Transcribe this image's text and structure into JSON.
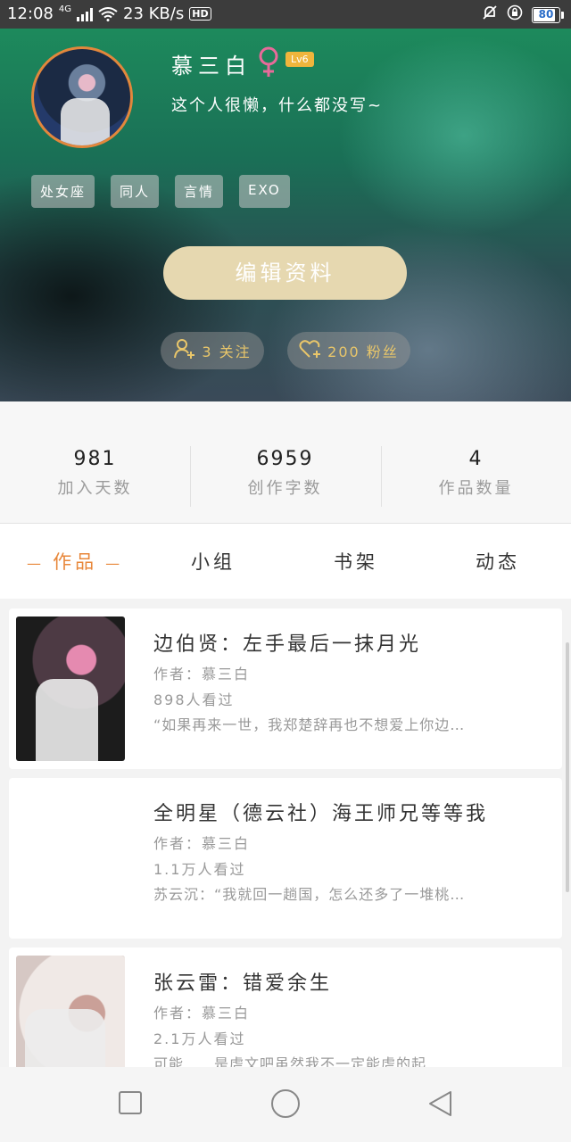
{
  "status_bar": {
    "time": "12:08",
    "network": "4G",
    "speed": "23 KB/s",
    "hd_label": "HD",
    "battery_level": "80"
  },
  "profile": {
    "username": "慕三白",
    "level": "Lv6",
    "bio": "这个人很懒，什么都没写~",
    "tags": [
      "处女座",
      "同人",
      "言情",
      "EXO"
    ],
    "edit_button": "编辑资料",
    "following": "3 关注",
    "fans": "200 粉丝",
    "accent_color": "#e8873a",
    "edit_button_color": "#e6d8b0"
  },
  "stats": [
    {
      "value": "981",
      "label": "加入天数"
    },
    {
      "value": "6959",
      "label": "创作字数"
    },
    {
      "value": "4",
      "label": "作品数量"
    }
  ],
  "tabs": [
    {
      "label": "作品",
      "active": true
    },
    {
      "label": "小组",
      "active": false
    },
    {
      "label": "书架",
      "active": false
    },
    {
      "label": "动态",
      "active": false
    }
  ],
  "works": [
    {
      "title": "边伯贤：左手最后一抹月光",
      "author": "作者：慕三白",
      "views": "898人看过",
      "excerpt": "“如果再来一世，我郑楚辞再也不想爱上你边…"
    },
    {
      "title": "全明星（德云社）海王师兄等等我",
      "author": "作者：慕三白",
      "views": "1.1万人看过",
      "excerpt": "苏云沉：“我就回一趟国，怎么还多了一堆桃…"
    },
    {
      "title": "张云雷：错爱余生",
      "author": "作者：慕三白",
      "views": "2.1万人看过",
      "excerpt": "可能……是虐文吧虽然我不一定能虐的起…"
    }
  ]
}
